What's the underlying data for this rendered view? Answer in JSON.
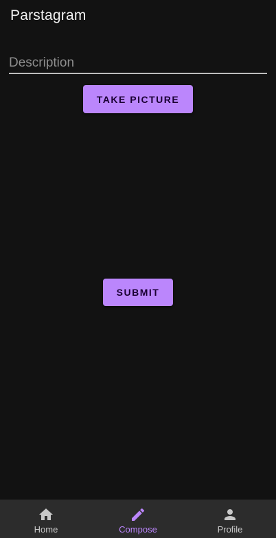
{
  "app": {
    "title": "Parstagram"
  },
  "compose": {
    "description_placeholder": "Description",
    "description_value": "",
    "take_picture_label": "Take Picture",
    "submit_label": "Submit"
  },
  "bottom_nav": {
    "items": [
      {
        "label": "Home",
        "icon": "home-icon",
        "active": false
      },
      {
        "label": "Compose",
        "icon": "pencil-icon",
        "active": true
      },
      {
        "label": "Profile",
        "icon": "person-icon",
        "active": false
      }
    ]
  },
  "colors": {
    "background": "#121212",
    "accent": "#bb86fc",
    "nav_background": "#2c2c2c",
    "nav_inactive": "#c8c8c8"
  }
}
